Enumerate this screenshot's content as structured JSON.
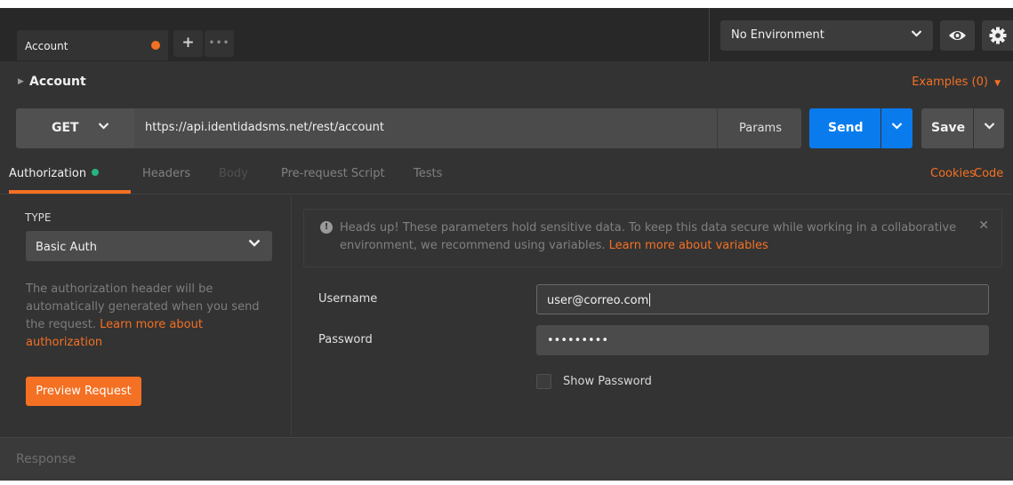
{
  "tabs": [
    {
      "label": "Account",
      "unsaved": true
    }
  ],
  "tab_actions": {
    "add": "+",
    "more": "•••"
  },
  "environment": {
    "selected": "No Environment"
  },
  "request": {
    "name": "Account",
    "examples_label": "Examples (0)",
    "method": "GET",
    "url": "https://api.identidadsms.net/rest/account",
    "params_label": "Params",
    "send_label": "Send",
    "save_label": "Save"
  },
  "subtabs": {
    "authorization": "Authorization",
    "headers": "Headers",
    "body": "Body",
    "prerequest": "Pre-request Script",
    "tests": "Tests",
    "cookies": "Cookies",
    "code": "Code"
  },
  "auth": {
    "type_label": "TYPE",
    "type_value": "Basic Auth",
    "description": "The authorization header will be automatically generated when you send the request.",
    "description_link": "Learn more about authorization",
    "preview_button": "Preview Request"
  },
  "notice": {
    "text": "Heads up! These parameters hold sensitive data. To keep this data secure while working in a collaborative environment, we recommend using variables.",
    "link": "Learn more about variables"
  },
  "form": {
    "username_label": "Username",
    "username_value": "user@correo.com",
    "password_label": "Password",
    "password_value": "•••••••••",
    "show_password_label": "Show Password"
  },
  "response": {
    "label": "Response"
  },
  "colors": {
    "accent": "#f47023",
    "send": "#097bed",
    "success": "#26b47f",
    "background": "#333333"
  }
}
